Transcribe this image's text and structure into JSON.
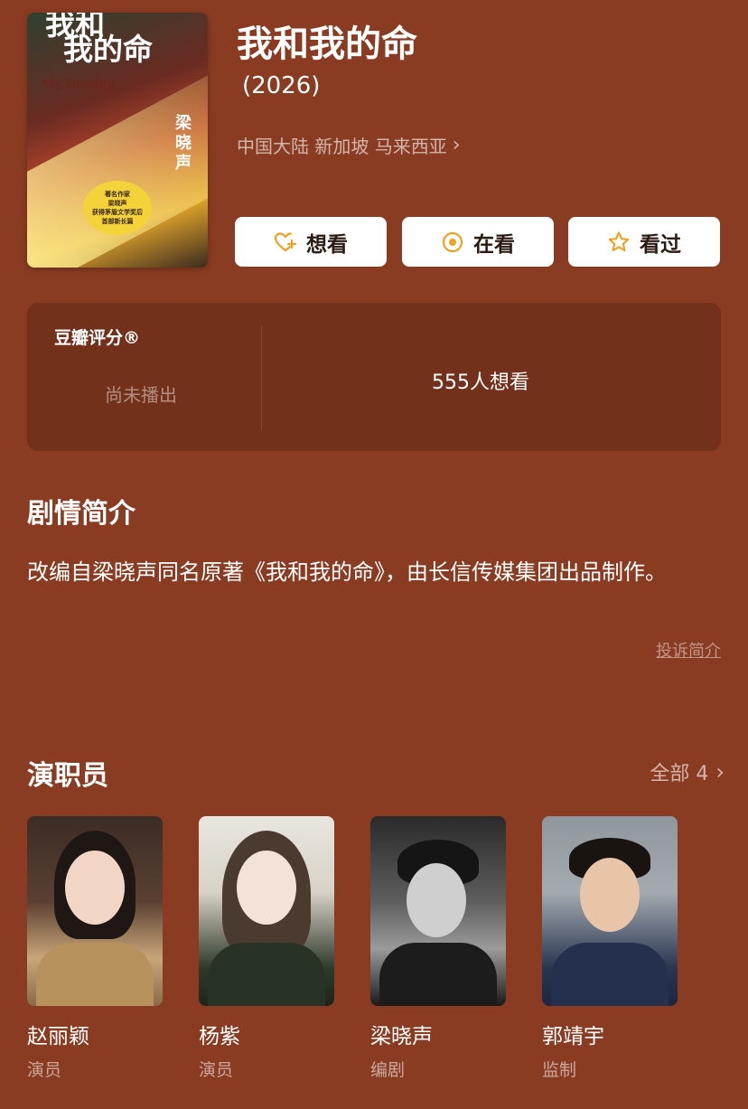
{
  "poster": {
    "title_lines": [
      "我和",
      "我的命"
    ],
    "title_en": "My Destiny",
    "author": "梁晓声",
    "badge_lines": [
      "著名作家",
      "梁晓声",
      "获得茅盾文学奖后",
      "首部新长篇"
    ]
  },
  "show": {
    "title": "我和我的命",
    "year": "(2026)",
    "regions": "中国大陆 新加坡 马来西亚"
  },
  "actions": {
    "want": "想看",
    "watching": "在看",
    "watched": "看过"
  },
  "rating": {
    "label": "豆瓣评分®",
    "status": "尚未播出",
    "wish_count": "555人想看"
  },
  "synopsis": {
    "title": "剧情简介",
    "text": "改编自梁晓声同名原著《我和我的命》，由长信传媒集团出品制作。",
    "report": "投诉简介"
  },
  "cast": {
    "title": "演职员",
    "all": "全部 4",
    "people": [
      {
        "name": "赵丽颖",
        "role": "演员"
      },
      {
        "name": "杨紫",
        "role": "演员"
      },
      {
        "name": "梁晓声",
        "role": "编剧"
      },
      {
        "name": "郭靖宇",
        "role": "监制"
      }
    ]
  },
  "colors": {
    "background": "#8a3c22",
    "panel": "#73301a",
    "button": "#ffffff",
    "accent": "#f0a020"
  }
}
